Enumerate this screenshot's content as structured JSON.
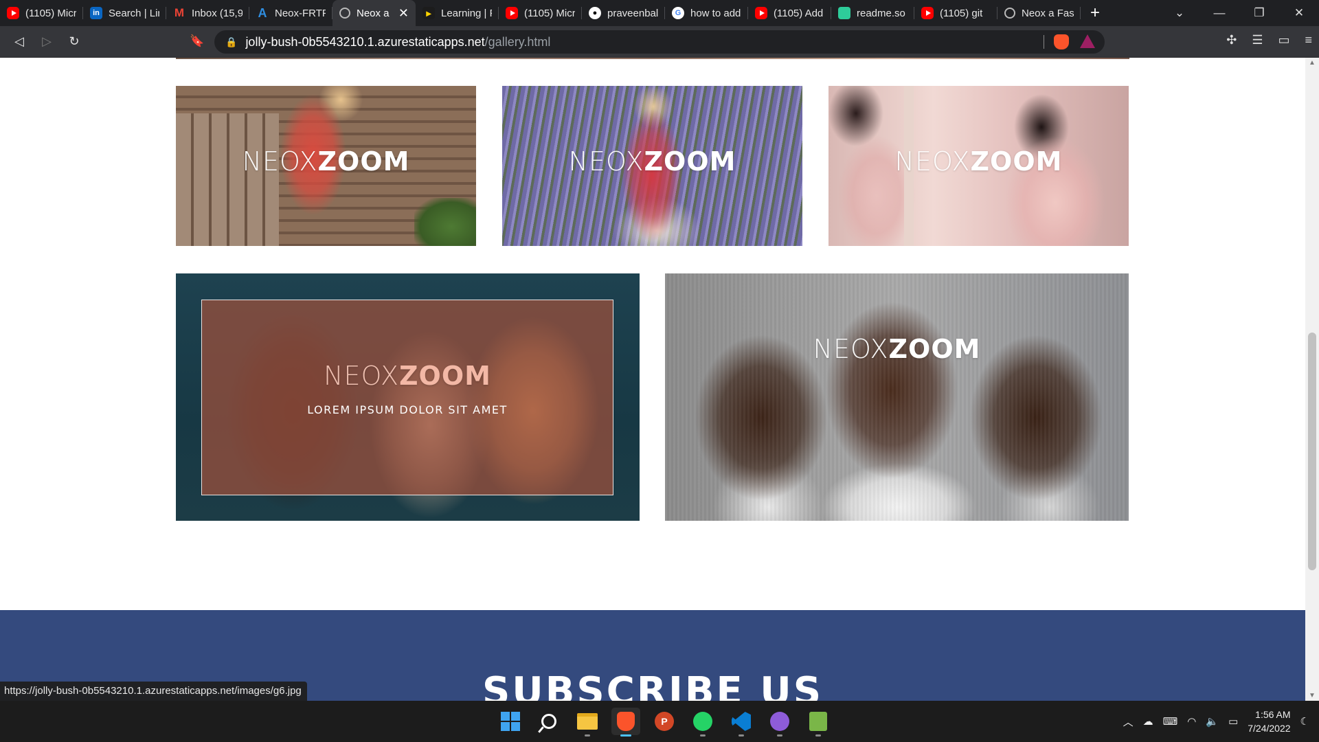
{
  "tabs": [
    {
      "icon": "youtube-icon",
      "favclass": "yt",
      "glyph": "",
      "title": "(1105) Micr"
    },
    {
      "icon": "linkedin-icon",
      "favclass": "li",
      "glyph": "in",
      "title": "Search | Lin"
    },
    {
      "icon": "gmail-icon",
      "favclass": "gm",
      "glyph": "M",
      "title": "Inbox (15,9"
    },
    {
      "icon": "azure-icon",
      "favclass": "az",
      "glyph": "A",
      "title": "Neox-FRTP"
    },
    {
      "icon": "globe-icon",
      "favclass": "globe",
      "glyph": "",
      "title": "Neox a",
      "active": true
    },
    {
      "icon": "learning-icon",
      "favclass": "ln",
      "glyph": "▸",
      "title": "Learning | F"
    },
    {
      "icon": "youtube-icon",
      "favclass": "yt",
      "glyph": "",
      "title": "(1105) Micr"
    },
    {
      "icon": "github-icon",
      "favclass": "gh",
      "glyph": "●",
      "title": "praveenbal"
    },
    {
      "icon": "google-icon",
      "favclass": "gg",
      "glyph": "G",
      "title": "how to add"
    },
    {
      "icon": "youtube-icon",
      "favclass": "yt",
      "glyph": "",
      "title": "(1105) Add"
    },
    {
      "icon": "readme-icon",
      "favclass": "rd",
      "glyph": "",
      "title": "readme.so"
    },
    {
      "icon": "youtube-icon",
      "favclass": "yt",
      "glyph": "",
      "title": "(1105) git"
    },
    {
      "icon": "globe-icon",
      "favclass": "globe",
      "glyph": "",
      "title": "Neox a Fas"
    }
  ],
  "address": {
    "host": "jolly-bush-0b5543210.1.azurestaticapps.net",
    "path": "/gallery.html"
  },
  "gallery": {
    "logo_thin": "NEOX",
    "logo_bold": "ZOOM",
    "hover_caption": "LOREM IPSUM DOLOR SIT AMET"
  },
  "subscribe": {
    "heading": "SUBSCRIBE US"
  },
  "status_url": "https://jolly-bush-0b5543210.1.azurestaticapps.net/images/g6.jpg",
  "taskbar": {
    "time": "1:56 AM",
    "date": "7/24/2022"
  },
  "colors": {
    "subscribe_bg": "#344a7e",
    "overlay": "#a0503c"
  }
}
